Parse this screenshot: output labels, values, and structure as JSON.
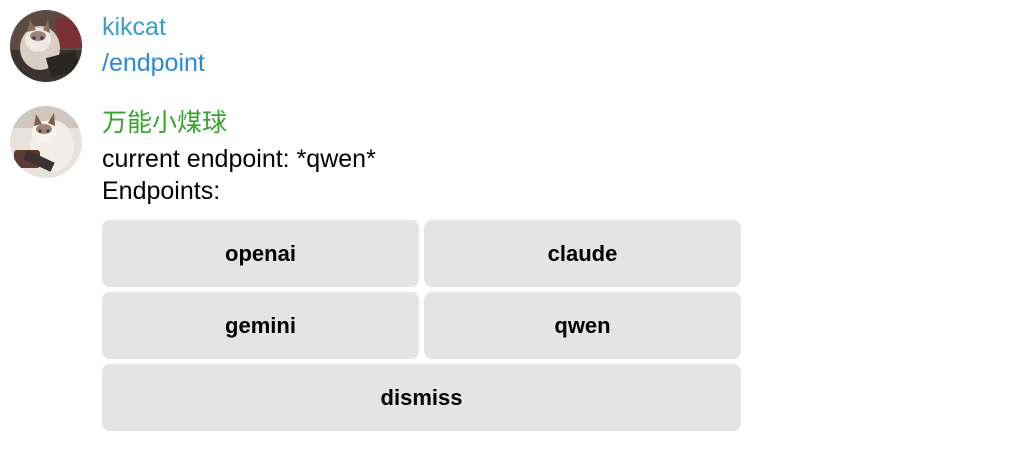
{
  "messages": [
    {
      "sender": "kikcat",
      "sender_color": "#3a9ec9",
      "avatar": "cat-photo-avatar",
      "text": "/endpoint"
    },
    {
      "sender": "万能小煤球",
      "sender_color": "#35a52d",
      "avatar": "cat-photo-avatar",
      "lines": [
        "current endpoint: *qwen*",
        "Endpoints:"
      ],
      "keyboard": {
        "buttons": [
          "openai",
          "claude",
          "gemini",
          "qwen",
          "dismiss"
        ]
      }
    }
  ],
  "colors": {
    "command_link": "#2a8ad8",
    "button_bg": "#e4e4e4"
  }
}
